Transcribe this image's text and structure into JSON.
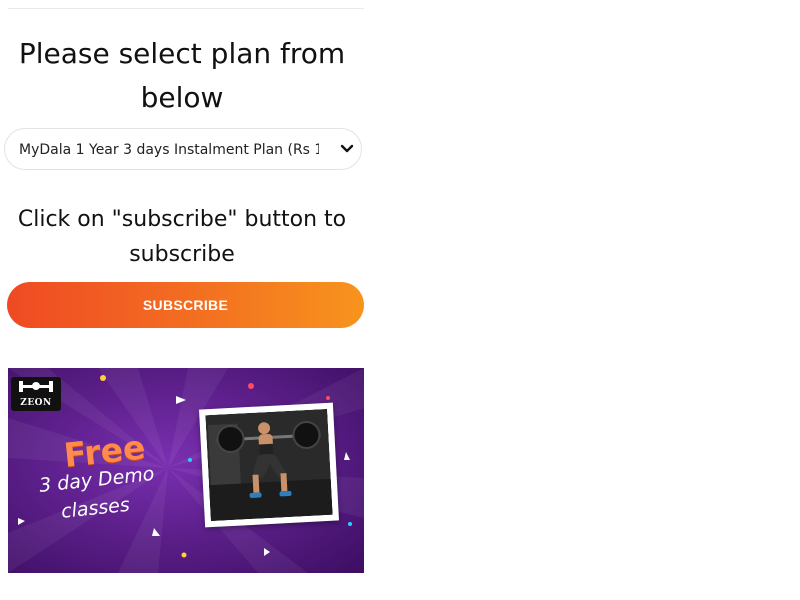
{
  "heading": "Please select plan from below",
  "plan_select": {
    "selected": "MyDala 1 Year 3 days Instalment Plan (Rs 1"
  },
  "instruction": "Click on \"subscribe\" button to subscribe",
  "subscribe_button": "SUBSCRIBE",
  "banner": {
    "brand": "ZEON",
    "free": "Free",
    "line1": "3 day Demo",
    "line2": "classes",
    "bg_color": "#5b1a86",
    "accent_color": "#ff8a4c"
  },
  "colors": {
    "button_start": "#ef4a23",
    "button_end": "#f7941d"
  }
}
